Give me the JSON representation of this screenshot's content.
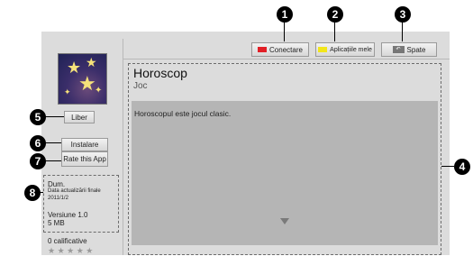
{
  "header": {
    "connect_label": "Conectare",
    "my_apps_label": "Aplicațiile mele",
    "back_label": "Spate",
    "connect_color": "#e21f26",
    "my_apps_color": "#f2e61a"
  },
  "app": {
    "title": "Horoscop",
    "category": "Joc",
    "description": "Horoscopul este jocul clasic.",
    "thumbnail_icon": "star-night-thumbnail",
    "price_label": "Liber"
  },
  "actions": {
    "install_label": "Instalare",
    "rate_label": "Rate this App"
  },
  "info": {
    "developer": "Dum.",
    "update_label": "Data actualizării finale",
    "update_date": "2011/1/2",
    "version": "Versiune 1.0",
    "size": "5 MB",
    "ratings": "0 calificative",
    "rating_stars": 0,
    "stars_glyphs": "★ ★ ★ ★ ★"
  },
  "callouts": [
    "1",
    "2",
    "3",
    "4",
    "5",
    "6",
    "7",
    "8"
  ],
  "scroll_icon": "triangle-down-icon"
}
